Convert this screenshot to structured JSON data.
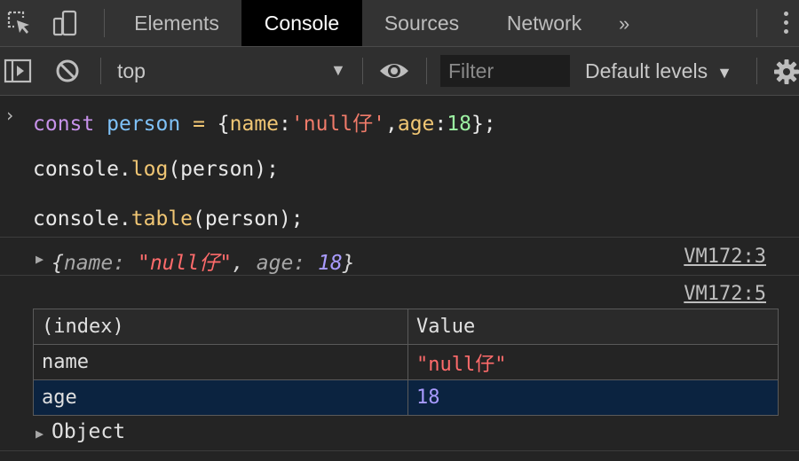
{
  "tabs": [
    "Elements",
    "Console",
    "Sources",
    "Network"
  ],
  "active_tab": "Console",
  "more_tabs_glyph": "»",
  "toolbar": {
    "context": "top",
    "context_caret": "▼",
    "filter_placeholder": "Filter",
    "levels": "Default levels",
    "levels_caret": "▼"
  },
  "console": {
    "prompt_glyph": "›",
    "code": {
      "line1": {
        "keyword": "const",
        "variable": "person",
        "op": "=",
        "open": "{",
        "key1": "name",
        "colon1": ":",
        "value1": "'null仔'",
        "comma": ",",
        "key2": "age",
        "colon2": ":",
        "value2": "18",
        "close": "};"
      },
      "line2": {
        "obj": "console.",
        "fn": "log",
        "args": "(person);"
      },
      "line3": {
        "obj": "console.",
        "fn": "table",
        "args": "(person);"
      }
    },
    "log_output": {
      "expander": "▶",
      "open": "{",
      "key1": "name:",
      "value1": "\"null仔\"",
      "sep": ", ",
      "key2": "age:",
      "value2": "18",
      "close": "}",
      "source": "VM172:3"
    },
    "table_output": {
      "source": "VM172:5",
      "headers": [
        "(index)",
        "Value"
      ],
      "rows": [
        {
          "index": "name",
          "value": "\"null仔\""
        },
        {
          "index": "age",
          "value": "18"
        }
      ],
      "footer_expander": "▶",
      "footer_label": "Object"
    }
  },
  "icons": [
    "inspect-element-icon",
    "device-toolbar-icon",
    "sidebar-toggle-icon",
    "clear-console-icon",
    "eye-icon",
    "gear-icon",
    "kebab-menu-icon"
  ],
  "colors": {
    "background": "#242424",
    "tabbar": "#333333",
    "active_tab": "#000000",
    "string": "#ff6b6b",
    "number": "#a99bff",
    "selected_row": "#0b2340"
  }
}
